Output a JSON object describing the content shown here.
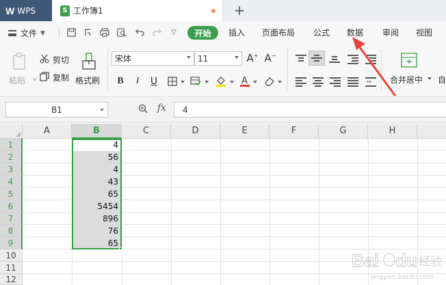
{
  "titlebar": {
    "app_label": "WPS",
    "doc_icon_letter": "S",
    "doc_title": "工作簿1",
    "new_tab": "+"
  },
  "menubar": {
    "file_label": "文件",
    "tabs": [
      "开始",
      "插入",
      "页面布局",
      "公式",
      "数据",
      "审阅",
      "视图"
    ]
  },
  "ribbon": {
    "paste": "粘贴",
    "cut": "剪切",
    "copy": "复制",
    "format_painter": "格式刷",
    "font_name": "宋体",
    "font_size": "11",
    "merge_center": "合并居中",
    "auto_wrap_partial": "自"
  },
  "formula_bar": {
    "name_box": "B1",
    "fx": "fx",
    "content": "4"
  },
  "grid": {
    "columns": [
      "A",
      "B",
      "C",
      "D",
      "E",
      "F",
      "G",
      "H"
    ],
    "rows": [
      "1",
      "2",
      "3",
      "4",
      "5",
      "6",
      "7",
      "8",
      "9",
      "10",
      "11",
      "12"
    ],
    "selected_column": "B",
    "column_b_values": [
      "4",
      "56",
      "4",
      "43",
      "65",
      "5454",
      "896",
      "76",
      "65"
    ]
  },
  "colors": {
    "accent_green": "#3c9e4a",
    "wps_tab": "#3f5878",
    "arrow_red": "#e8463b"
  },
  "watermark": {
    "text": "Baidu 经验",
    "sub": "jingyan.baidu.com"
  }
}
